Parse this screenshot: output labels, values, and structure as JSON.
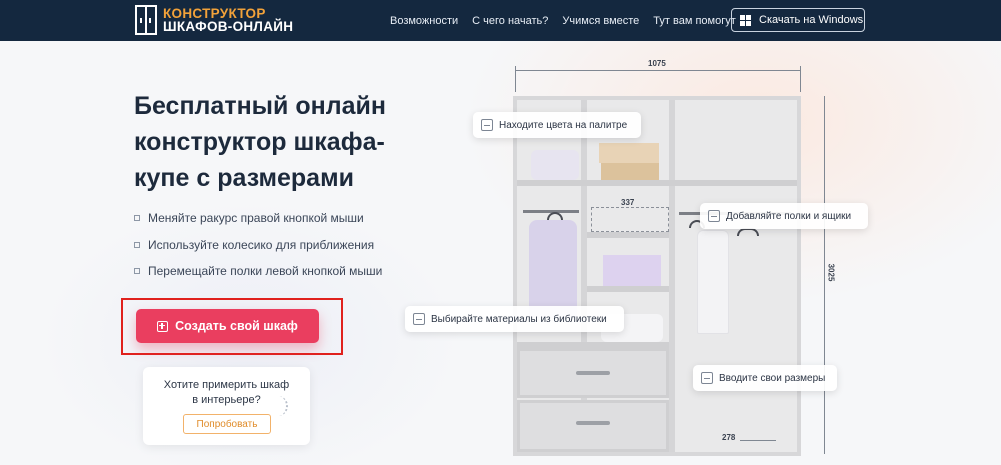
{
  "header": {
    "logo_line1": "КОНСТРУКТОР",
    "logo_line2": "ШКАФОВ-ОНЛАЙН",
    "nav": [
      "Возможности",
      "С чего начать?",
      "Учимся вместе",
      "Тут вам помогут"
    ],
    "download_label": "Скачать на Windows",
    "colors": {
      "background": "#14283f",
      "logo_accent": "#f2a23a"
    }
  },
  "hero": {
    "title_lines": [
      "Бесплатный онлайн",
      "конструктор шкафа-",
      "купе с размерами"
    ],
    "bullets": [
      "Меняйте ракурс правой кнопкой мыши",
      "Используйте колесико для приближения",
      "Перемещайте полки левой кнопкой мыши"
    ],
    "cta_label": "Создать свой шкаф",
    "cta_color": "#ea3e5f",
    "try_text_line1": "Хотите примерить шкаф",
    "try_text_line2": "в интерьере?",
    "try_button": "Попробовать"
  },
  "wardrobe": {
    "dim_width": "1075",
    "dim_height": "3025",
    "dim_shelf": "337",
    "dim_depth": "278",
    "chips": {
      "palette": "Находите цвета на палитре",
      "shelves": "Добавляйте полки и ящики",
      "materials": "Выбирайте материалы из библиотеки",
      "sizes": "Вводите свои размеры"
    },
    "icons": [
      "palette-icon",
      "shelf-icon",
      "materials-icon",
      "ruler-icon",
      "plus-icon",
      "windows-icon"
    ]
  }
}
